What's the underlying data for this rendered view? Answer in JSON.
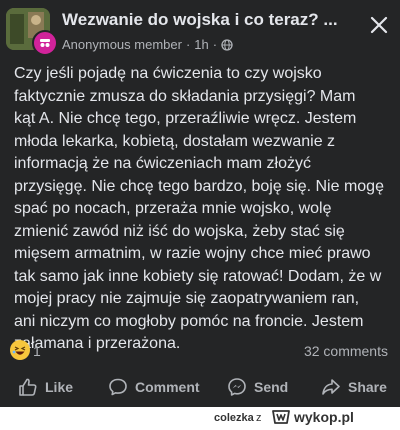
{
  "post": {
    "title": "Wezwanie do wojska i co teraz? ...",
    "author": "Anonymous member",
    "separator": "·",
    "time": "1h",
    "separator2": "·",
    "privacy_icon": "globe-icon",
    "body": "Czy jeśli pojadę na ćwiczenia to czy wojsko\nfaktycznie zmusza do składania przysięgi? Mam\nkąt A. Nie chcę tego, przeraźliwie wręcz. Jestem\nmłoda lekarka, kobietą, dostałam wezwanie z\ninformacją że na ćwiczeniach mam złożyć\nprzysięgę. Nie chcę tego bardzo, boję się. Nie mogę\nspać po nocach, przeraża mnie wojsko, wolę\nzmienić zawód niż iść do wojska, żeby stać się\nmięsem armatnim, w razie wojny chce mieć prawo\ntak samo jak inne kobiety się ratować! Dodam, że w\nmojej pracy nie zajmuje się zaopatrywaniem ran,\nani niczym co  mogłoby pomóc na froncie. Jestem\nzałamana i przerażona."
  },
  "reactions": {
    "emoji": "haha-emoji",
    "count": "1",
    "comments": "32 comments"
  },
  "actions": {
    "like": "Like",
    "comment": "Comment",
    "send": "Send",
    "share": "Share"
  },
  "footer": {
    "user": "colezka",
    "z": "z",
    "site": "wykop.pl"
  },
  "colors": {
    "card_bg": "#242526",
    "text_primary": "#e4e6eb",
    "text_secondary": "#b0b3b8",
    "avatar": "#d1239a"
  }
}
